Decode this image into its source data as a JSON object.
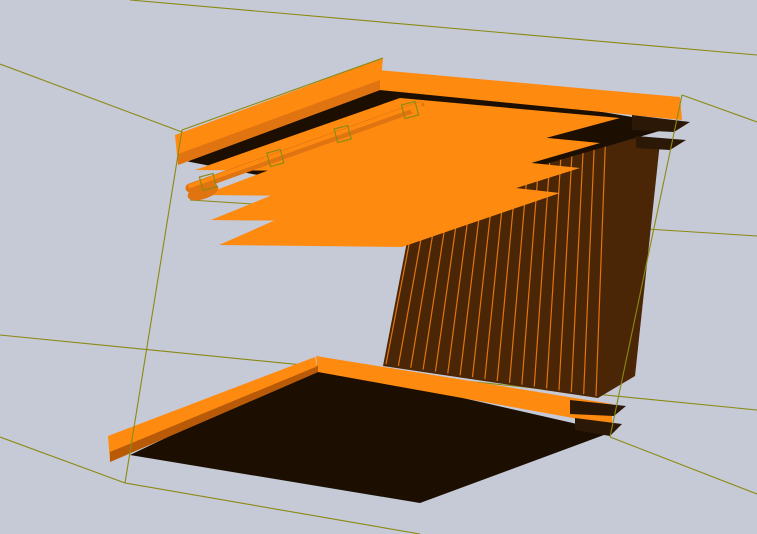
{
  "viewport": {
    "background": "#c6c9d6",
    "colors": {
      "wireframe": "#8a8a12",
      "orange": "#ff8a10",
      "orange_mid": "#e07410",
      "orange_dark": "#b85a08",
      "dark": "#1c0f02",
      "dark_shade": "#2c1806",
      "fin_body": "#4a2606"
    }
  },
  "scene": {
    "description_icon": "3d-duct-assembly-icon",
    "fin_count": 18,
    "top_slat_count": 4,
    "pipe_clamp_count": 4
  }
}
